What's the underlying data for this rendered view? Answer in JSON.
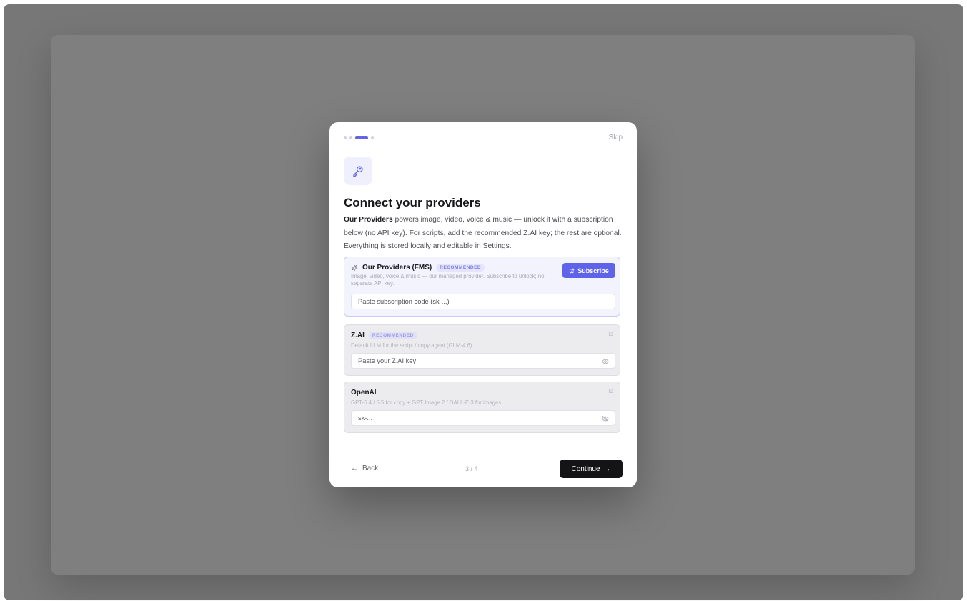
{
  "modal": {
    "step_dots": 4,
    "active_step_dot": 3,
    "skip_label": "Skip",
    "icon": "key-icon",
    "title": "Connect your providers",
    "intro_bold": "Our Providers",
    "intro_text": " powers image, video, voice & music — unlock it with a subscription below (no API key). For scripts, add the recommended Z.AI key; the rest are optional. Everything is stored locally and editable in Settings."
  },
  "providers": {
    "fms": {
      "icon": "sparkle-icon",
      "title": "Our Providers (FMS)",
      "badge": "RECOMMENDED",
      "description": "Image, video, voice & music — our managed provider. Subscribe to unlock; no separate API key.",
      "subscribe_label": "Subscribe",
      "input_value": "Paste subscription code (sk-...)"
    },
    "zai": {
      "title": "Z.AI",
      "badge": "RECOMMENDED",
      "description": "Default LLM for the script / copy agent (GLM-4.6).",
      "input_value": "Paste your Z.AI key",
      "toggle_icon": "eye-icon",
      "link_icon": "external-link-icon"
    },
    "openai": {
      "title": "OpenAI",
      "description": "GPT-5.4 / 5.5 for copy + GPT Image 2 / DALL-E 3 for images.",
      "input_value": "sk-...",
      "toggle_icon": "eye-off-icon",
      "link_icon": "external-link-icon"
    }
  },
  "footer": {
    "back_label": "Back",
    "step_count": "3 / 4",
    "continue_label": "Continue"
  },
  "colors": {
    "accent": "#5f63ea",
    "primary_button": "#141416",
    "backdrop": "#7f7f7f"
  }
}
